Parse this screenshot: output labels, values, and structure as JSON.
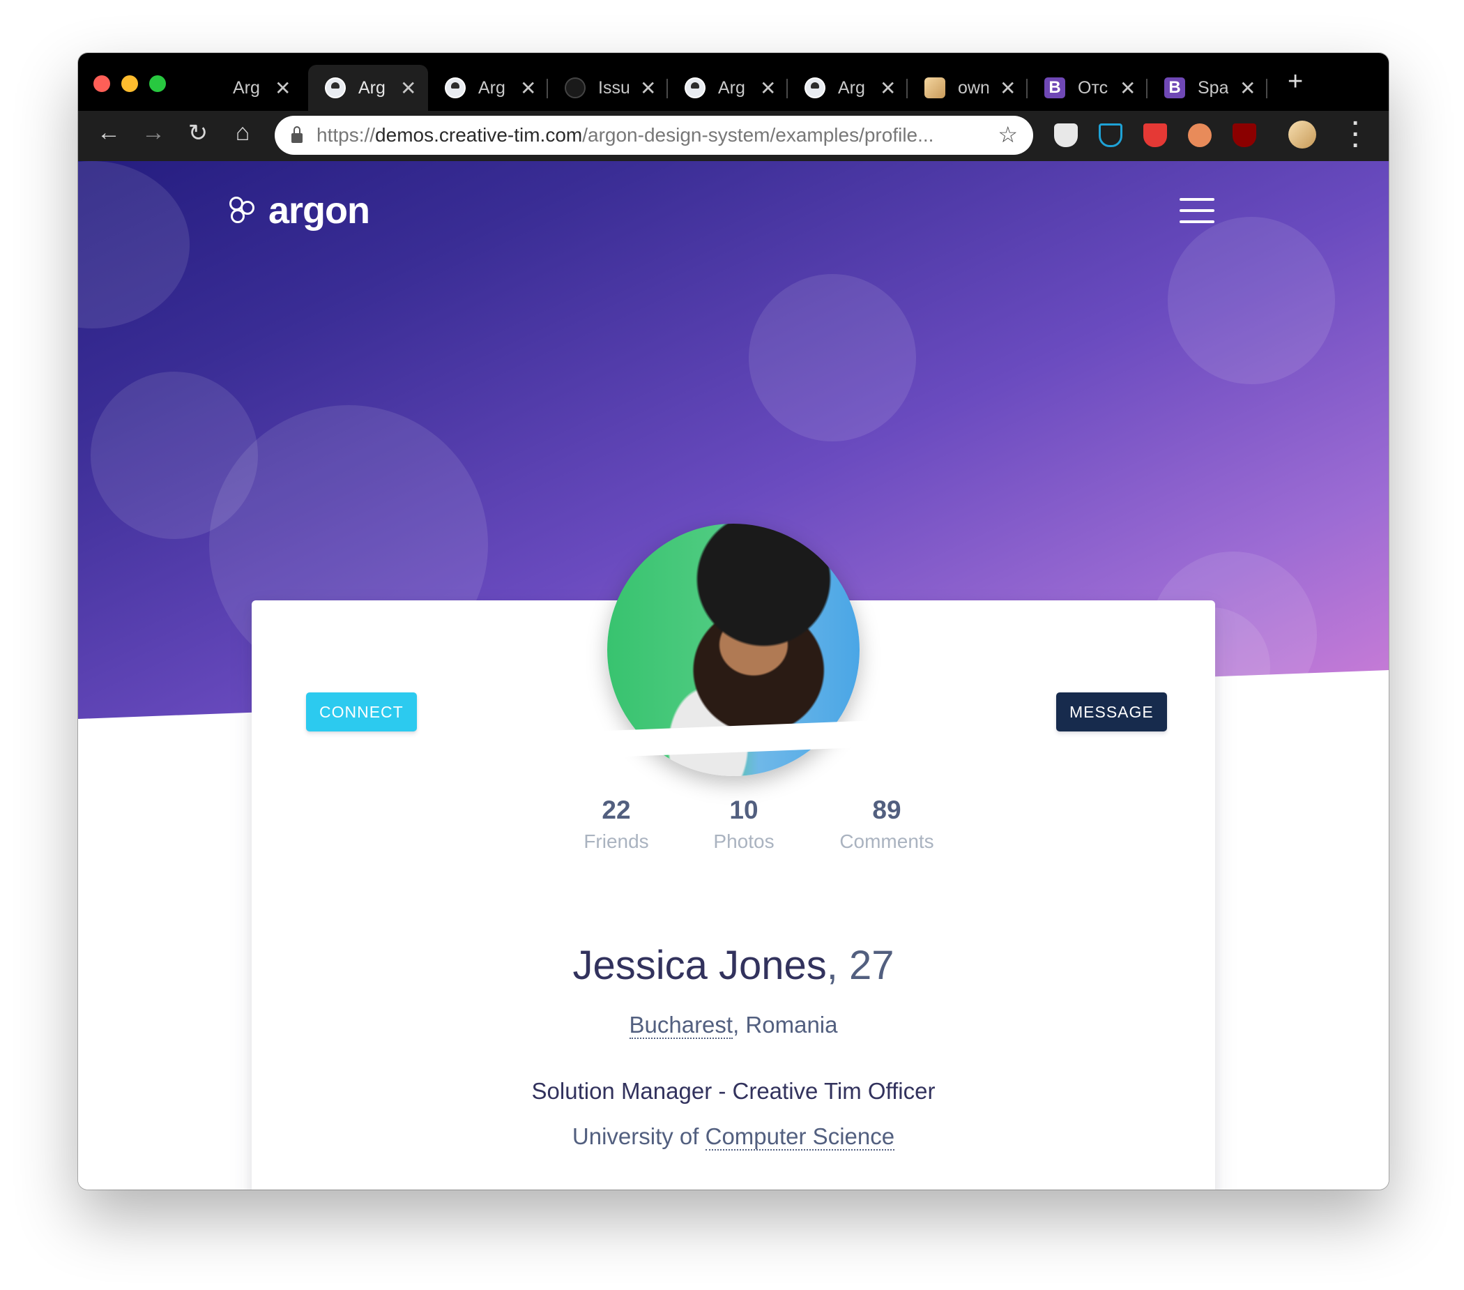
{
  "browser": {
    "tabs": [
      {
        "title": "Arg",
        "icon": "argon-favicon",
        "active": false
      },
      {
        "title": "Arg",
        "icon": "argon-favicon",
        "active": true
      },
      {
        "title": "Arg",
        "icon": "argon-favicon",
        "active": false
      },
      {
        "title": "Issu",
        "icon": "github-favicon",
        "active": false
      },
      {
        "title": "Arg",
        "icon": "argon-favicon",
        "active": false
      },
      {
        "title": "Arg",
        "icon": "argon-favicon",
        "active": false
      },
      {
        "title": "own",
        "icon": "avatar-favicon",
        "active": false
      },
      {
        "title": "Отс",
        "icon": "bootstrap-favicon",
        "active": false
      },
      {
        "title": "Spa",
        "icon": "bootstrap-favicon",
        "active": false
      }
    ],
    "close_glyph": "✕",
    "new_tab_glyph": "+",
    "url_scheme": "https://",
    "url_host": "demos.creative-tim.com",
    "url_path": "/argon-design-system/examples/profile..."
  },
  "navbar": {
    "brand": "argon"
  },
  "profile": {
    "connect_label": "CONNECT",
    "message_label": "MESSAGE",
    "stats": [
      {
        "value": "22",
        "label": "Friends"
      },
      {
        "value": "10",
        "label": "Photos"
      },
      {
        "value": "89",
        "label": "Comments"
      }
    ],
    "name": "Jessica Jones",
    "age": ", 27",
    "city": "Bucharest",
    "country": ", Romania",
    "job": "Solution Manager - Creative Tim Officer",
    "education_prefix": "University of ",
    "education_highlight": "Computer Science"
  },
  "colors": {
    "connect": "#2ccaef",
    "message": "#172b4d",
    "hero_start": "#251d80",
    "hero_end": "#d17fd7"
  }
}
